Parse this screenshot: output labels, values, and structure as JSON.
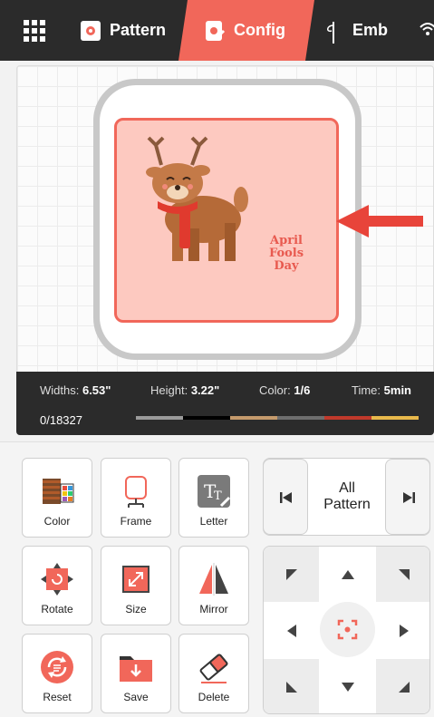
{
  "colors": {
    "accent": "#f1675a",
    "bar": "#2b2b2b",
    "hoop_fill": "#fdc9c0"
  },
  "tabs": [
    {
      "label": "Pattern",
      "icon": "pattern-icon"
    },
    {
      "label": "Config",
      "icon": "config-icon",
      "active": true
    },
    {
      "label": "Emb",
      "icon": "needle-icon"
    }
  ],
  "canvas": {
    "design_text": "April Fools Day"
  },
  "status": {
    "widths_label": "Widths:",
    "widths_value": "6.53\"",
    "height_label": "Height:",
    "height_value": "3.22\"",
    "color_label": "Color:",
    "color_value": "1/6",
    "time_label": "Time:",
    "time_value": "5min",
    "progress": "0/18327",
    "thread_colors": [
      "#9a9a9a",
      "#000000",
      "#c49a6c",
      "#6e6e6e",
      "#c0392b",
      "#e8b84b"
    ]
  },
  "tools": [
    {
      "label": "Color",
      "icon": "color-icon"
    },
    {
      "label": "Frame",
      "icon": "frame-icon"
    },
    {
      "label": "Letter",
      "icon": "letter-icon"
    },
    {
      "label": "Rotate",
      "icon": "rotate-icon"
    },
    {
      "label": "Size",
      "icon": "size-icon"
    },
    {
      "label": "Mirror",
      "icon": "mirror-icon"
    },
    {
      "label": "Reset",
      "icon": "reset-icon"
    },
    {
      "label": "Save",
      "icon": "save-icon"
    },
    {
      "label": "Delete",
      "icon": "delete-icon"
    }
  ],
  "pattern_nav": {
    "line1": "All",
    "line2": "Pattern"
  }
}
